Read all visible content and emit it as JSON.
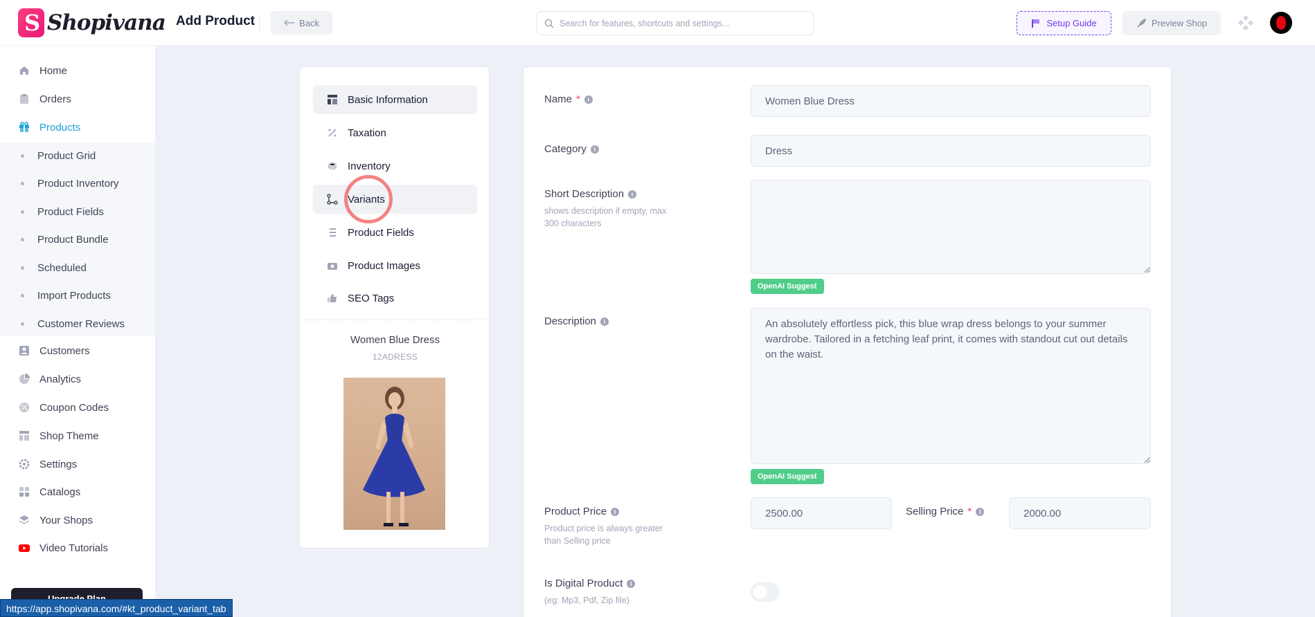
{
  "app": {
    "brand": "Shopivana",
    "page_title": "Add Product"
  },
  "header": {
    "back_label": "Back",
    "search_placeholder": "Search for features, shortcuts and settings...",
    "setup_label": "Setup Guide",
    "preview_label": "Preview Shop"
  },
  "sidebar": {
    "items": [
      {
        "label": "Home",
        "icon": "home-icon"
      },
      {
        "label": "Orders",
        "icon": "clipboard-icon"
      },
      {
        "label": "Products",
        "icon": "gift-icon",
        "active": true
      },
      {
        "label": "Customers",
        "icon": "user-icon"
      },
      {
        "label": "Analytics",
        "icon": "pie-chart-icon"
      },
      {
        "label": "Coupon Codes",
        "icon": "coupon-icon"
      },
      {
        "label": "Shop Theme",
        "icon": "layout-icon"
      },
      {
        "label": "Settings",
        "icon": "gear-icon"
      },
      {
        "label": "Catalogs",
        "icon": "catalog-icon"
      },
      {
        "label": "Your Shops",
        "icon": "layers-icon"
      },
      {
        "label": "Video Tutorials",
        "icon": "youtube-icon"
      }
    ],
    "sub_items": [
      "Product Grid",
      "Product Inventory",
      "Product Fields",
      "Product Bundle",
      "Scheduled",
      "Import Products",
      "Customer Reviews"
    ],
    "upgrade_label": "Upgrade Plan"
  },
  "tabs": [
    {
      "label": "Basic Information",
      "icon": "layout-icon"
    },
    {
      "label": "Taxation",
      "icon": "percent-icon"
    },
    {
      "label": "Inventory",
      "icon": "box-icon"
    },
    {
      "label": "Variants",
      "icon": "variants-icon"
    },
    {
      "label": "Product Fields",
      "icon": "list-icon"
    },
    {
      "label": "Product Images",
      "icon": "camera-icon"
    },
    {
      "label": "SEO Tags",
      "icon": "thumbs-up-icon"
    }
  ],
  "product": {
    "name": "Women Blue Dress",
    "sku": "12ADRESS"
  },
  "form": {
    "name_label": "Name",
    "name_value": "Women Blue Dress",
    "category_label": "Category",
    "category_value": "Dress",
    "short_desc_label": "Short Description",
    "short_desc_hint": "shows description if empty, max 300 characters",
    "short_desc_value": "",
    "ai_suggest_label": "OpenAI Suggest",
    "description_label": "Description",
    "description_value": "An absolutely effortless pick, this blue wrap dress belongs to your summer wardrobe. Tailored in a fetching leaf print, it comes with standout cut out details on the waist.",
    "product_price_label": "Product Price",
    "product_price_hint": "Product price is always greater than Selling price",
    "product_price_value": "2500.00",
    "selling_price_label": "Selling Price",
    "selling_price_value": "2000.00",
    "digital_label": "Is Digital Product",
    "digital_hint": "(eg: Mp3, Pdf, Zip file)",
    "required_mark": "*"
  },
  "status_url": "https://app.shopivana.com/#kt_product_variant_tab",
  "colors": {
    "accent": "#1aa1d6",
    "setup": "#7239ea",
    "ai": "#50cd89",
    "required": "#f1416c"
  }
}
